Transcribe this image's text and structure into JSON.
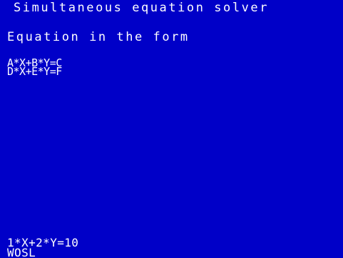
{
  "screen": {
    "background": "#0000c8",
    "foreground": "#ffffff",
    "title": "Simultaneous equation solver",
    "heading": "Equation in the form",
    "equations": [
      "A*X+B*Y=C",
      "D*X+E*Y=F"
    ],
    "input_line": "1*X+2*Y=10",
    "status_line": "WOSL"
  }
}
